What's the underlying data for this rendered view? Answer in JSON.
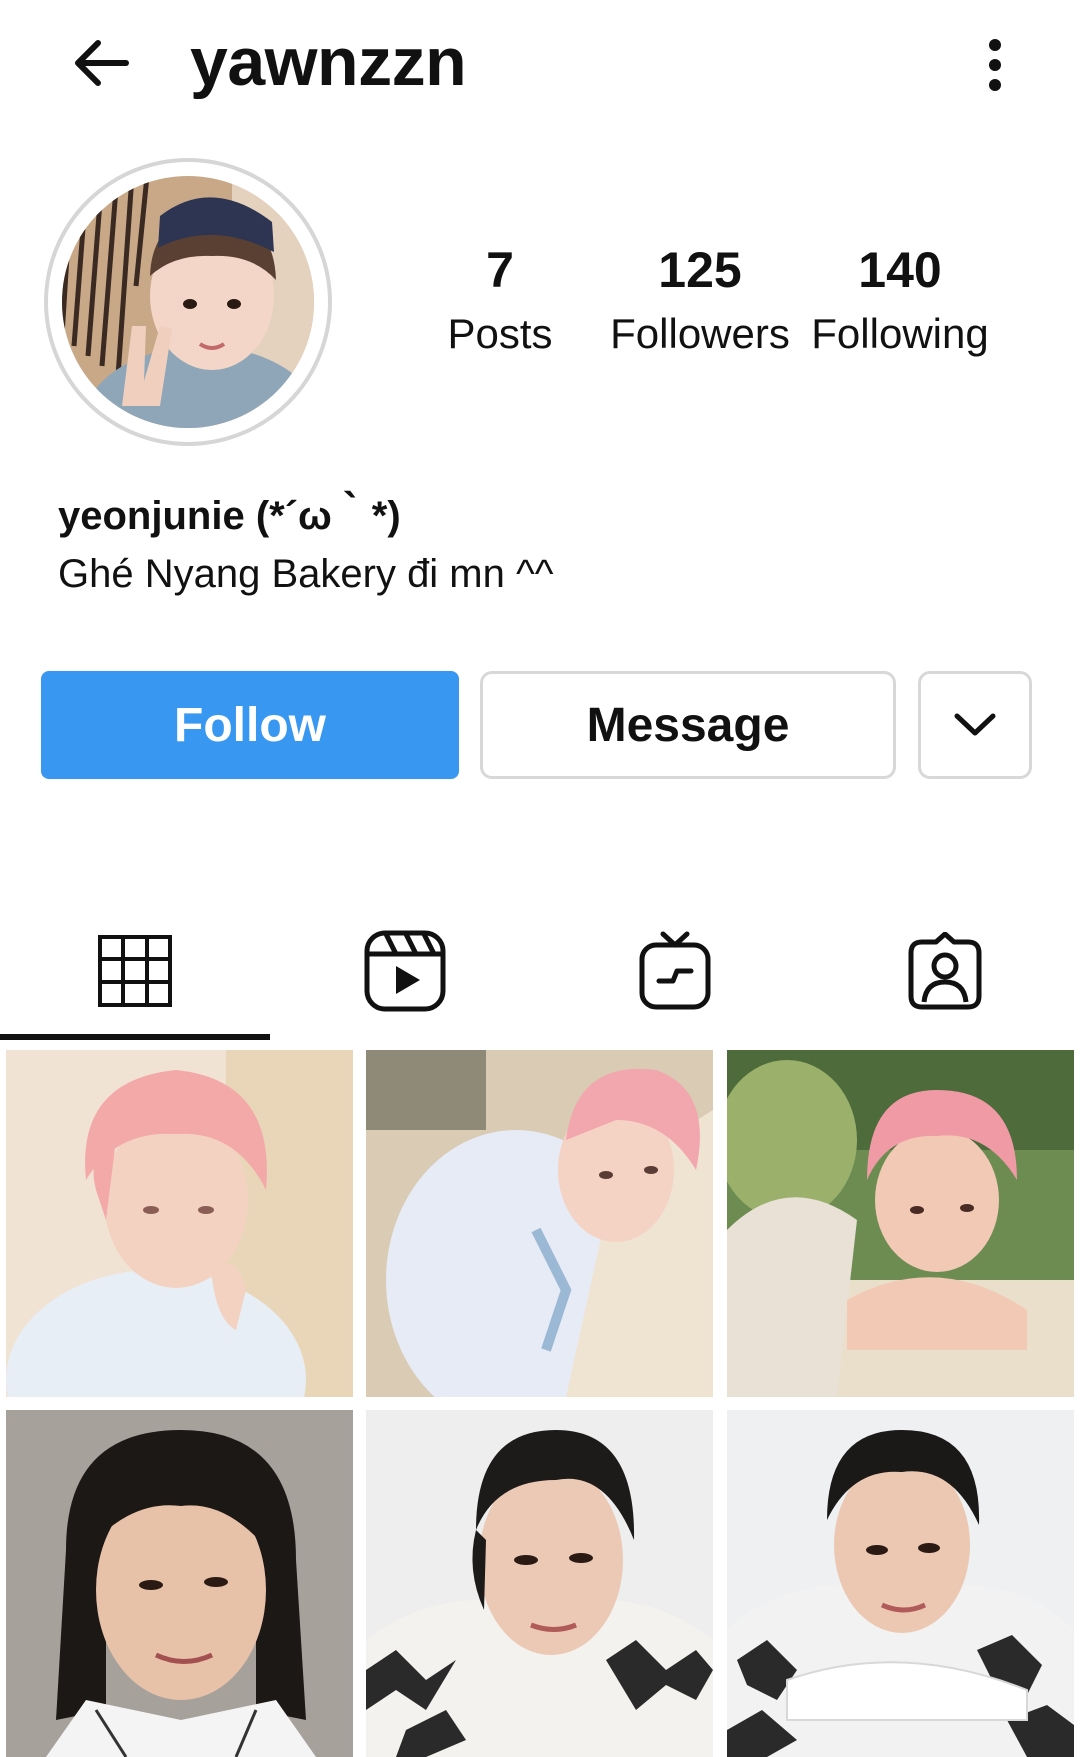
{
  "header": {
    "username": "yawnzzn",
    "back_icon": "arrow-left-icon",
    "more_icon": "more-vertical-icon"
  },
  "profile": {
    "stats": {
      "posts": {
        "count": "7",
        "label": "Posts"
      },
      "followers": {
        "count": "125",
        "label": "Followers"
      },
      "following": {
        "count": "140",
        "label": "Following"
      }
    },
    "display_name": "yeonjunie (*´ω｀*)",
    "bio": "Ghé Nyang Bakery đi mn ^^"
  },
  "actions": {
    "follow_label": "Follow",
    "message_label": "Message",
    "dropdown_icon": "chevron-down-icon"
  },
  "tabs": [
    {
      "name": "posts-grid",
      "icon": "grid-icon",
      "active": true
    },
    {
      "name": "reels",
      "icon": "reels-icon",
      "active": false
    },
    {
      "name": "igtv",
      "icon": "igtv-icon",
      "active": false
    },
    {
      "name": "tagged",
      "icon": "tagged-user-icon",
      "active": false
    }
  ],
  "posts": [
    {
      "theme": "pink-hair-soft-light"
    },
    {
      "theme": "pink-hair-hammock"
    },
    {
      "theme": "pink-hair-garden"
    },
    {
      "theme": "dark-hair-closeup"
    },
    {
      "theme": "dark-hair-knit-sweater"
    },
    {
      "theme": "dark-hair-white-backdrop"
    }
  ],
  "colors": {
    "follow_button": "#3897f0",
    "border": "#d8d8d8",
    "text": "#111111"
  }
}
